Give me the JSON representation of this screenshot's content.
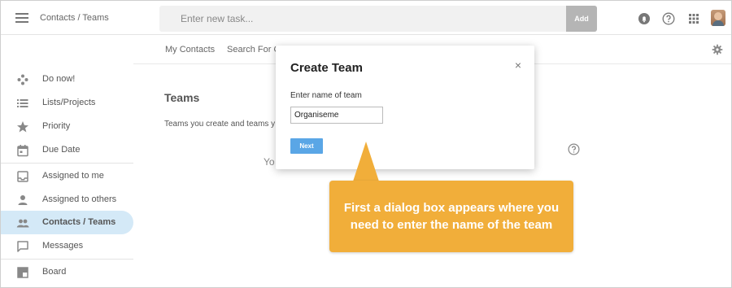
{
  "header": {
    "breadcrumb": "Contacts / Teams",
    "task_placeholder": "Enter new task...",
    "add_label": "Add"
  },
  "subtabs": {
    "my_contacts": "My Contacts",
    "search_for_contacts": "Search For C"
  },
  "sidebar": {
    "items": [
      {
        "label": "Do now!",
        "icon": "gamepad-icon"
      },
      {
        "label": "Lists/Projects",
        "icon": "list-icon"
      },
      {
        "label": "Priority",
        "icon": "star-icon"
      },
      {
        "label": "Due Date",
        "icon": "calendar-icon"
      },
      {
        "label": "Assigned to me",
        "icon": "inbox-icon"
      },
      {
        "label": "Assigned to others",
        "icon": "person-icon"
      },
      {
        "label": "Contacts / Teams",
        "icon": "people-icon",
        "active": true
      },
      {
        "label": "Messages",
        "icon": "message-icon"
      },
      {
        "label": "Board",
        "icon": "board-icon"
      }
    ]
  },
  "main": {
    "title": "Teams",
    "description": "Teams you create and teams y",
    "empty_text": "Yo"
  },
  "dialog": {
    "title": "Create Team",
    "close_label": "×",
    "field_label": "Enter name of team",
    "field_value": "Organiseme",
    "next_label": "Next"
  },
  "callout": {
    "text": "First a dialog box appears where you need to enter the name of the team"
  },
  "colors": {
    "active_bg": "#d4e9f7",
    "add_button": "#b5b5b5",
    "next_button": "#5aa6e6",
    "callout": "#f1ae3a"
  }
}
